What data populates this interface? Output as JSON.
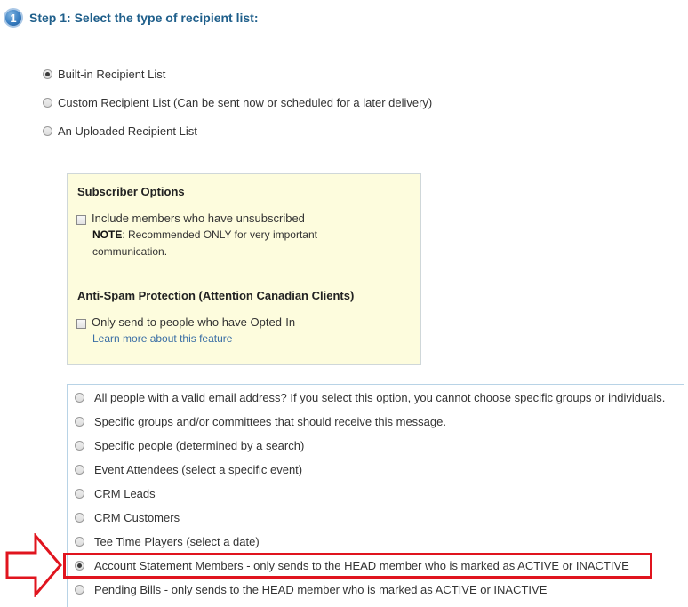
{
  "step": {
    "number": "1",
    "title": "Step 1: Select the type of recipient list:"
  },
  "list_types": [
    {
      "label": "Built-in Recipient List",
      "checked": true
    },
    {
      "label": "Custom Recipient List (Can be sent now or scheduled for a later delivery)",
      "checked": false
    },
    {
      "label": "An Uploaded Recipient List",
      "checked": false
    }
  ],
  "subscriber_options": {
    "title": "Subscriber Options",
    "include_unsubscribed_label": "Include members who have unsubscribed",
    "note_prefix": "NOTE",
    "note_text": ": Recommended ONLY for very important communication.",
    "anti_spam_title": "Anti-Spam Protection (Attention Canadian Clients)",
    "opted_in_label": "Only send to people who have Opted-In",
    "learn_more_link": "Learn more about this feature"
  },
  "recipient_options": [
    {
      "label": "All people with a valid email address? If you select this option, you cannot choose specific groups or individuals.",
      "checked": false
    },
    {
      "label": "Specific groups and/or committees that should receive this message.",
      "checked": false
    },
    {
      "label": "Specific people (determined by a search)",
      "checked": false
    },
    {
      "label": "Event Attendees (select a specific event)",
      "checked": false
    },
    {
      "label": "CRM Leads",
      "checked": false
    },
    {
      "label": "CRM Customers",
      "checked": false
    },
    {
      "label": "Tee Time Players (select a date)",
      "checked": false
    },
    {
      "label": "Account Statement Members - only sends to the HEAD member who is marked as ACTIVE or INACTIVE",
      "checked": true
    },
    {
      "label": "Pending Bills - only sends to the HEAD member who is marked as ACTIVE or INACTIVE",
      "checked": false
    }
  ],
  "colors": {
    "step_title": "#1f5f8b",
    "options_panel_bg": "#fdfcdd",
    "highlight": "#e0141e",
    "link": "#3a6ea5"
  }
}
